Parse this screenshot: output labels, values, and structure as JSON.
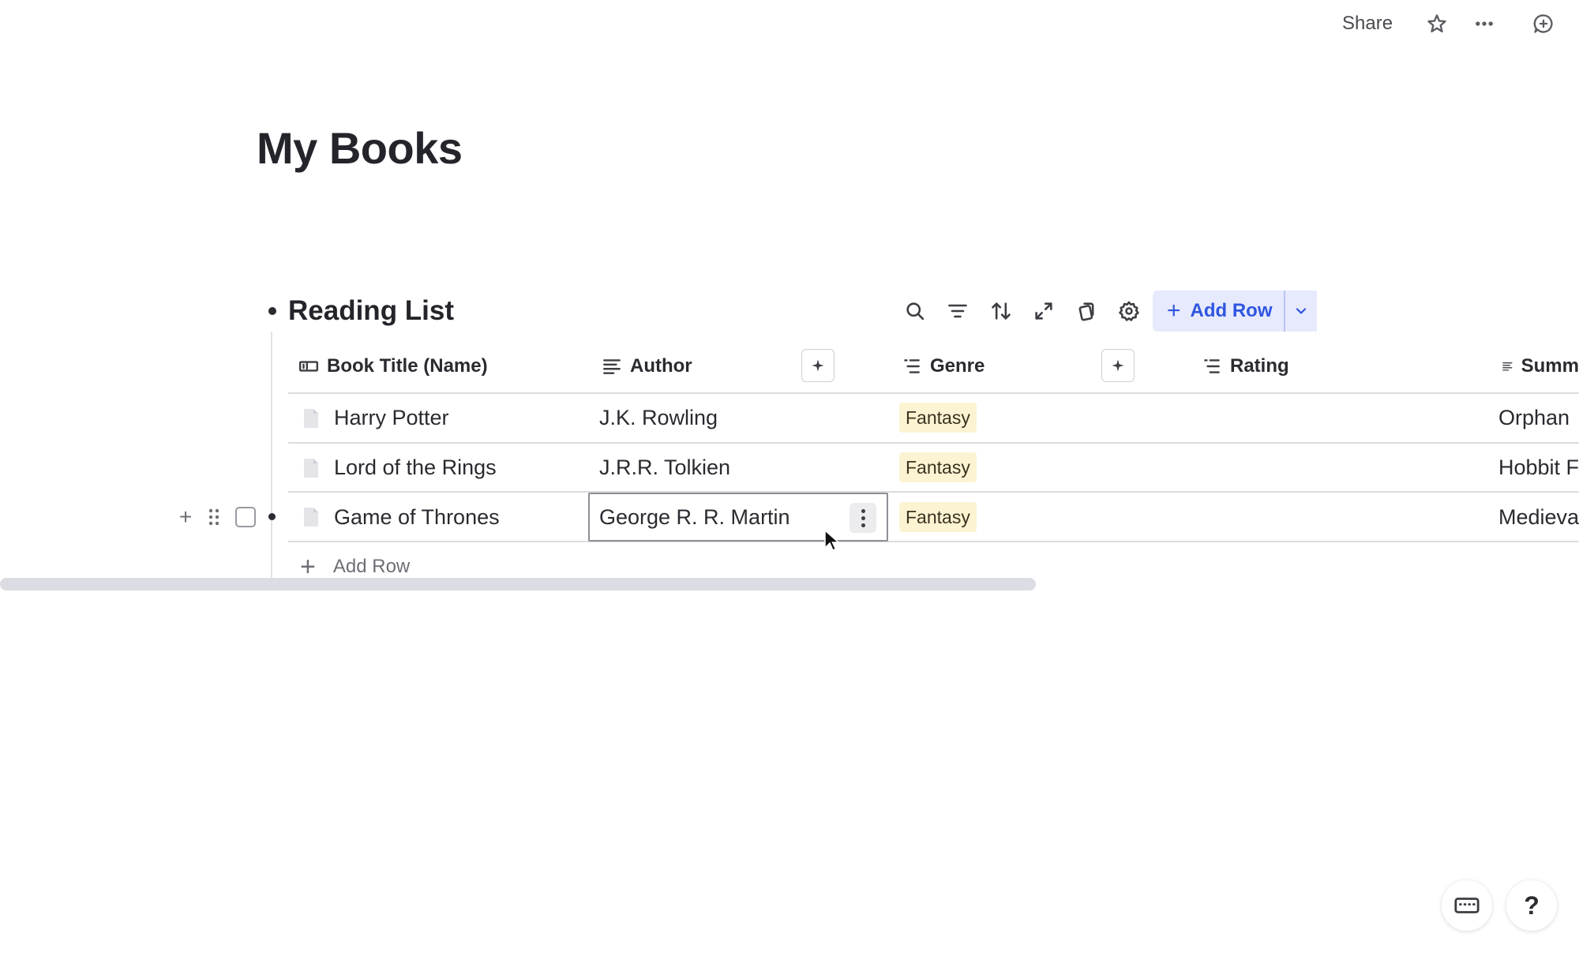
{
  "header": {
    "share_label": "Share",
    "icons": [
      "star-icon",
      "more-horizontal-icon",
      "add-comment-icon"
    ]
  },
  "page": {
    "title": "My Books"
  },
  "table_block": {
    "title": "Reading List",
    "toolbar_icons": [
      "search-icon",
      "filter-icon",
      "sort-icon",
      "expand-icon",
      "copy-icon",
      "settings-icon"
    ],
    "add_row_button": "Add Row",
    "add_row_link": "Add Row",
    "columns": [
      {
        "label": "Book Title (Name)",
        "icon": "title-column-icon"
      },
      {
        "label": "Author",
        "icon": "text-column-icon"
      },
      {
        "label": "Genre",
        "icon": "select-column-icon"
      },
      {
        "label": "Rating",
        "icon": "select-column-icon"
      },
      {
        "label": "Summ",
        "icon": "text-column-icon"
      }
    ],
    "rows": [
      {
        "title": "Harry Potter",
        "author": "J.K. Rowling",
        "genre": "Fantasy",
        "rating": "",
        "summary": "Orphan"
      },
      {
        "title": "Lord of the Rings",
        "author": "J.R.R. Tolkien",
        "genre": "Fantasy",
        "rating": "",
        "summary": "Hobbit F"
      },
      {
        "title": "Game of Thrones",
        "author": "George R. R. Martin",
        "genre": "Fantasy",
        "rating": "",
        "summary": "Medieva"
      }
    ],
    "tag_color": "#fbf3d2",
    "accent_color": "#2f55e0"
  },
  "footer": {
    "help_label": "?"
  }
}
